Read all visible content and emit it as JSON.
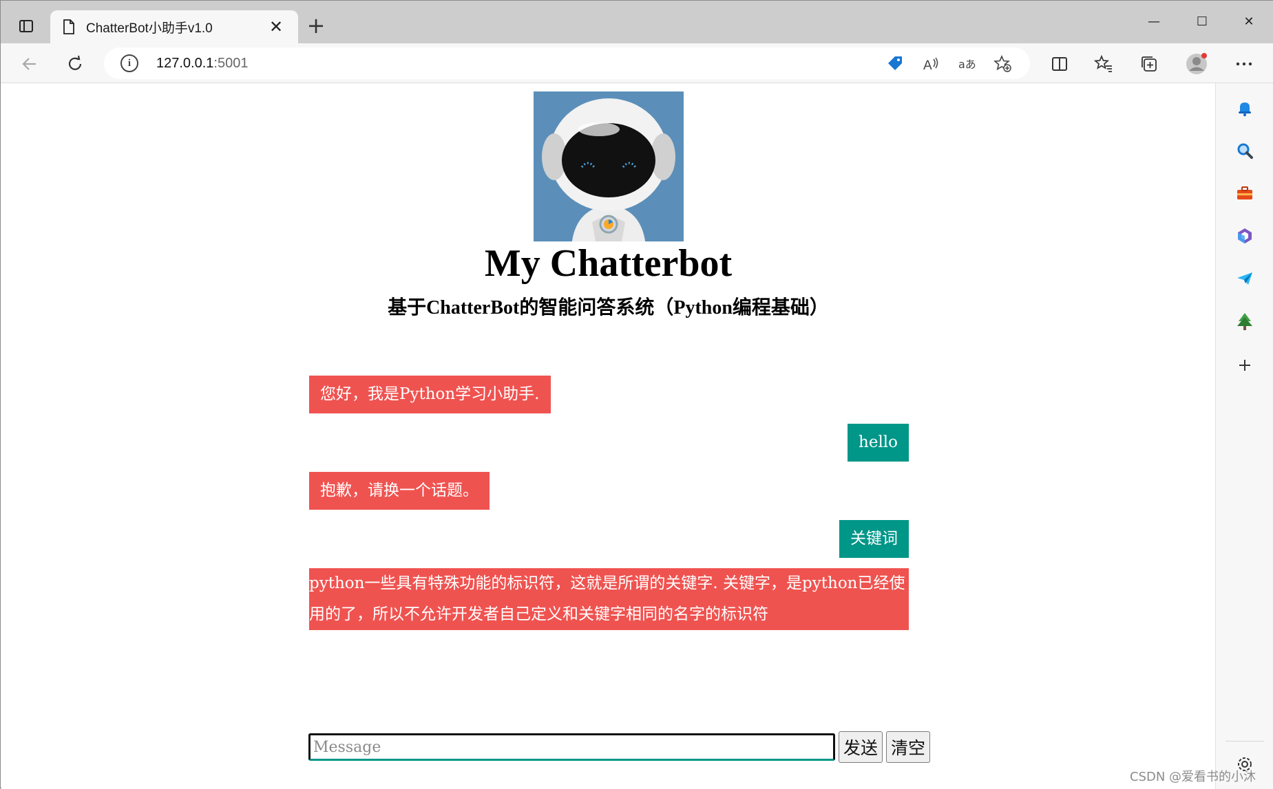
{
  "browser": {
    "tab": {
      "title": "ChatterBot小助手v1.0",
      "close_glyph": "✕"
    },
    "new_tab_glyph": "+",
    "window_controls": {
      "minimize": "—",
      "maximize": "☐",
      "close": "✕"
    },
    "address": {
      "host": "127.0.0.1",
      "port": ":5001"
    }
  },
  "page": {
    "title": "My Chatterbot",
    "subtitle": "基于ChatterBot的智能问答系统（Python编程基础）"
  },
  "messages": [
    {
      "role": "bot",
      "text": "您好，我是Python学习小助手."
    },
    {
      "role": "user",
      "text": "hello"
    },
    {
      "role": "bot",
      "text": "抱歉，请换一个话题。"
    },
    {
      "role": "user",
      "text": "关键词"
    },
    {
      "role": "bot",
      "text": " python一些具有特殊功能的标识符，这就是所谓的关键字. 关键字，是python已经使用的了，所以不允许开发者自己定义和关键字相同的名字的标识符 "
    }
  ],
  "composer": {
    "placeholder": "Message",
    "send_label": "发送",
    "clear_label": "清空"
  },
  "watermark": "CSDN @爱看书的小沐",
  "colors": {
    "bot_bubble": "#ef5350",
    "user_bubble": "#009688",
    "avatar_bg": "#5b8fb9"
  },
  "icons": {
    "sidebar": [
      "bell-icon",
      "search-icon",
      "toolbox-icon",
      "copilot-icon",
      "send-icon",
      "tree-icon",
      "add-icon",
      "settings-icon"
    ]
  }
}
